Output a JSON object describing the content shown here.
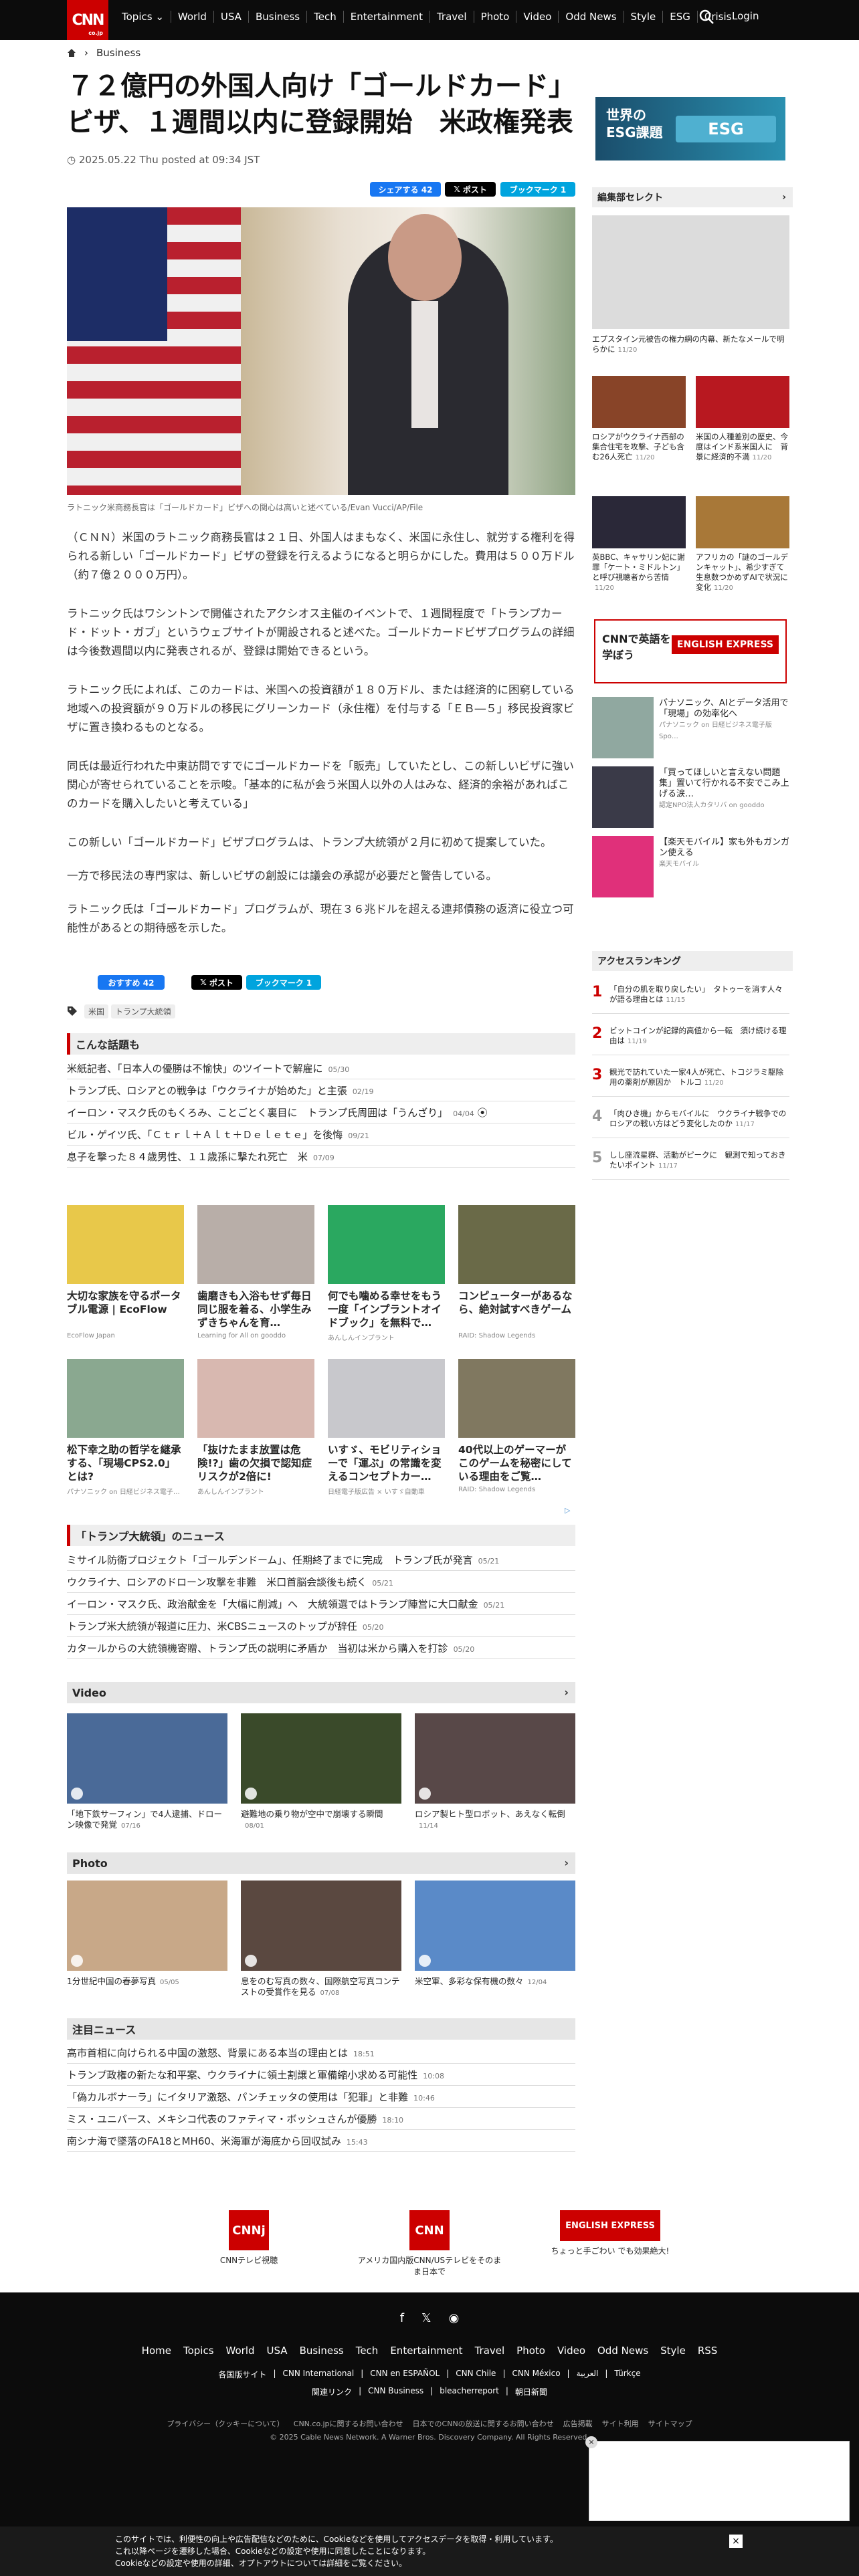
{
  "header": {
    "logo": "CNN",
    "logo_sub": "co.jp",
    "nav": [
      "Topics",
      "World",
      "USA",
      "Business",
      "Tech",
      "Entertainment",
      "Travel",
      "Photo",
      "Video",
      "Odd News",
      "Style",
      "ESG",
      "Crisis"
    ],
    "login": "Login"
  },
  "breadcrumb": {
    "section": "Business"
  },
  "article": {
    "title": "７２億円の外国人向け「ゴールドカード」ビザ、１週間以内に登録開始　米政権発表",
    "date": "2025.05.22 Thu posted at 09:34 JST",
    "share": {
      "facebook": "シェアする 42",
      "x": "ポスト",
      "hatena": "ブックマーク 1",
      "facebook2": "おすすめ 42",
      "x2": "ポスト",
      "hatena2": "ブックマーク 1"
    },
    "caption": "ラトニック米商務長官は「ゴールドカード」ビザへの関心は高いと述べている/Evan Vucci/AP/File",
    "paragraphs": [
      "（ＣＮＮ）米国のラトニック商務長官は２１日、外国人はまもなく、米国に永住し、就労する権利を得られる新しい「ゴールドカード」ビザの登録を行えるようになると明らかにした。費用は５００万ドル（約７億２０００万円）。",
      "ラトニック氏はワシントンで開催されたアクシオス主催のイベントで、１週間程度で「トランプカード・ドット・ガブ」というウェブサイトが開設されると述べた。ゴールドカードビザプログラムの詳細は今後数週間以内に発表されるが、登録は開始できるという。",
      "ラトニック氏によれば、このカードは、米国への投資額が１８０万ドル、または経済的に困窮している地域への投資額が９０万ドルの移民にグリーンカード（永住権）を付与する「ＥＢ―５」移民投資家ビザに置き換わるものとなる。",
      "同氏は最近行われた中東訪問ですでにゴールドカードを「販売」していたとし、この新しいビザに強い関心が寄せられていることを示唆。「基本的に私が会う米国人以外の人はみな、経済的余裕があればこのカードを購入したいと考えている」",
      "この新しい「ゴールドカード」ビザプログラムは、トランプ大統領が２月に初めて提案していた。",
      "一方で移民法の専門家は、新しいビザの創設には議会の承認が必要だと警告している。",
      "ラトニック氏は「ゴールドカード」プログラムが、現在３６兆ドルを超える連邦債務の返済に役立つ可能性があるとの期待感を示した。"
    ],
    "tags": [
      "米国",
      "トランプ大統領"
    ]
  },
  "popular": {
    "heading": "こんな話題も",
    "items": [
      {
        "t": "米紙記者、「日本人の優勝は不愉快」のツイートで解雇に",
        "d": "05/30"
      },
      {
        "t": "トランプ氏、ロシアとの戦争は「ウクライナが始めた」と主張",
        "d": "02/19"
      },
      {
        "t": "イーロン・マスク氏のもくろみ、ことごとく裏目に　トランプ氏周囲は「うんざり」",
        "d": "04/04"
      },
      {
        "t": "ビル・ゲイツ氏、「Ｃｔｒｌ＋Ａｌｔ＋Ｄｅｌｅｔｅ」を後悔",
        "d": "09/21"
      },
      {
        "t": "息子を撃った８４歳男性、１１歳孫に撃たれ死亡　米",
        "d": "07/09"
      }
    ]
  },
  "ads": [
    {
      "t": "大切な家族を守るポータブル電源 | EcoFlow",
      "s": "EcoFlow Japan",
      "c": "#e8c84a"
    },
    {
      "t": "歯磨きも入浴もせず毎日同じ服を着る、小学生みずきちゃんを育…",
      "s": "Learning for All on gooddo",
      "c": "#b8aea8"
    },
    {
      "t": "何でも噛める幸せをもう一度「インプラントオイドブック」を無料で…",
      "s": "あんしんインプラント",
      "c": "#2aa860"
    },
    {
      "t": "コンピューターがあるなら、絶対試すべきゲーム",
      "s": "RAID: Shadow Legends",
      "c": "#6a6a48"
    },
    {
      "t": "松下幸之助の哲学を継承する、「現場CPS2.0」とは?",
      "s": "パナソニック on 日経ビジネス電子…",
      "c": "#8aa890"
    },
    {
      "t": "「抜けたまま放置は危険!?」歯の欠損で認知症リスクが2倍に!",
      "s": "あんしんインプラント",
      "c": "#d8b8b0"
    },
    {
      "t": "いすゞ、モビリティショーで「運ぶ」の常識を変えるコンセプトカー…",
      "s": "日経電子版広告 × いすゞ自動車",
      "c": "#c8c8cc"
    },
    {
      "t": "40代以上のゲーマーがこのゲームを秘密にしている理由をご覧…",
      "s": "RAID: Shadow Legends",
      "c": "#807860"
    }
  ],
  "trump_news": {
    "heading": "「トランプ大統領」のニュース",
    "items": [
      {
        "t": "ミサイル防衛プロジェクト「ゴールデンドーム」、任期終了までに完成　トランプ氏が発言",
        "d": "05/21"
      },
      {
        "t": "ウクライナ、ロシアのドローン攻撃を非難　米口首脳会談後も続く",
        "d": "05/21"
      },
      {
        "t": "イーロン・マスク氏、政治献金を「大幅に削減」へ　大統領選ではトランプ陣営に大口献金",
        "d": "05/21"
      },
      {
        "t": "トランプ米大統領が報道に圧力、米CBSニュースのトップが辞任",
        "d": "05/20"
      },
      {
        "t": "カタールからの大統領機寄贈、トランプ氏の説明に矛盾か　当初は米から購入を打診",
        "d": "05/20"
      }
    ]
  },
  "video": {
    "heading": "Video",
    "items": [
      {
        "t": "「地下鉄サーフィン」で4人逮捕、ドローン映像で発覚",
        "d": "07/16",
        "c": "#4a6a98"
      },
      {
        "t": "避難地の乗り物が空中で崩壊する瞬間",
        "d": "08/01",
        "c": "#3a4a2a"
      },
      {
        "t": "ロシア製ヒト型ロボット、あえなく転倒",
        "d": "11/14",
        "c": "#584848"
      }
    ]
  },
  "photo": {
    "heading": "Photo",
    "items": [
      {
        "t": "1分世紀中国の春夢写真",
        "d": "05/05",
        "c": "#c8a888"
      },
      {
        "t": "息をのむ写真の数々、国際航空写真コンテストの受賞作を見る",
        "d": "07/08",
        "c": "#5a4840"
      },
      {
        "t": "米空軍、多彩な保有機の数々",
        "d": "12/04",
        "c": "#5a8ac8"
      }
    ]
  },
  "featured": {
    "heading": "注目ニュース",
    "items": [
      {
        "t": "高市首相に向けられる中国の激怒、背景にある本当の理由とは",
        "d": "18:51"
      },
      {
        "t": "トランプ政権の新たな和平案、ウクライナに領土割譲と軍備縮小求める可能性",
        "d": "10:08"
      },
      {
        "t": "「偽カルボナーラ」にイタリア激怒、パンチェッタの使用は「犯罪」と非難",
        "d": "10:46"
      },
      {
        "t": "ミス・ユニバース、メキシコ代表のファティマ・ボッシュさんが優勝",
        "d": "18:10"
      },
      {
        "t": "南シナ海で墜落のFA18とMH60、米海軍が海底から回収試み",
        "d": "15:43"
      }
    ]
  },
  "footer_links": [
    {
      "b": "CNNj",
      "t": "CNNテレビ視聴"
    },
    {
      "b": "CNN",
      "t": "アメリカ国内版CNN/USテレビをそのまま日本で"
    },
    {
      "b": "ENGLISH EXPRESS",
      "t": "ちょっと手ごわい でも効果絶大!"
    }
  ],
  "footer": {
    "nav": [
      "Home",
      "Topics",
      "World",
      "USA",
      "Business",
      "Tech",
      "Entertainment",
      "Travel",
      "Photo",
      "Video",
      "Odd News",
      "Style",
      "RSS"
    ],
    "nav2": [
      "各国版サイト",
      "CNN International",
      "CNN en ESPAÑOL",
      "CNN Chile",
      "CNN México",
      "العربية",
      "Türkçe"
    ],
    "nav3": [
      "関連リンク",
      "CNN Business",
      "bleacherreport",
      "朝日新聞"
    ],
    "nav4": [
      "プライバシー（クッキーについて）",
      "CNN.co.jpに関するお問い合わせ",
      "日本でのCNNの放送に関するお問い合わせ",
      "広告掲載",
      "サイト利用",
      "サイトマップ"
    ],
    "copyright": "© 2025 Cable News Network. A Warner Bros. Discovery Company. All Rights Reserved."
  },
  "cookie": {
    "l1": "このサイトでは、利便性の向上や広告配信などのために、Cookieなどを使用してアクセスデータを取得・利用しています。",
    "l2": "これ以降ページを遷移した場合、Cookieなどの設定や使用に同意したことになります。",
    "l3": "Cookieなどの設定や使用の詳細、オプトアウトについては詳細をご覧ください。"
  },
  "sidebar": {
    "banner": "世界の ESG課題",
    "banner_esg": "ESG",
    "editor_heading": "編集部セレクト",
    "editor_items": [
      {
        "t": "エプスタイン元被告の権力網の内幕、新たなメールで明らかに",
        "d": "11/20",
        "c": "#dcdcdc"
      },
      {
        "t": "ロシアがウクライナ西部の集合住宅を攻撃、子ども含む26人死亡",
        "d": "11/20",
        "c": "#884428"
      },
      {
        "t": "米国の人種差別の歴史、今度はインド系米国人に　背景に経済的不満",
        "d": "11/20",
        "c": "#b81820"
      },
      {
        "t": "英BBC、キャサリン妃に謝罪「ケート・ミドルトン」と呼び視聴者から苦情",
        "d": "11/20",
        "c": "#2a2838"
      },
      {
        "t": "アフリカの「謎のゴールデンキャット」、希少すぎて生息数つかめずAIで状況に変化",
        "d": "11/20",
        "c": "#a87838"
      }
    ],
    "english_banner": "CNNで英語を学ぼう",
    "sponsored": [
      {
        "t": "パナソニック、AIとデータ活用で「現場」の効率化へ",
        "s": "パナソニック on 日経ビジネス電子版Spo…",
        "c": "#90a8a0"
      },
      {
        "t": "「買ってほしいと言えない問題集」置いて行かれる不安でこみ上げる涙…",
        "s": "認定NPO法人カタリバ on gooddo",
        "c": "#3a3a48"
      },
      {
        "t": "【楽天モバイル】家も外もガンガン使える",
        "s": "楽天モバイル",
        "c": "#e0307a"
      }
    ],
    "ranking_heading": "アクセスランキング",
    "ranking": [
      {
        "t": "「自分の肌を取り戻したい」　タトゥーを消す人々が語る理由とは",
        "d": "11/15"
      },
      {
        "t": "ビットコインが記録的高値から一転　須け続ける理由は",
        "d": "11/19"
      },
      {
        "t": "観光で訪れていた一家4人が死亡、トコジラミ駆除用の薬剤が原因か　トルコ",
        "d": "11/20"
      },
      {
        "t": "「肉ひき機」からモバイルに　ウクライナ戦争でのロシアの戦い方はどう変化したのか",
        "d": "11/17"
      },
      {
        "t": "しし座流星群、活動がピークに　観測で知っておきたいポイント",
        "d": "11/17"
      }
    ]
  }
}
